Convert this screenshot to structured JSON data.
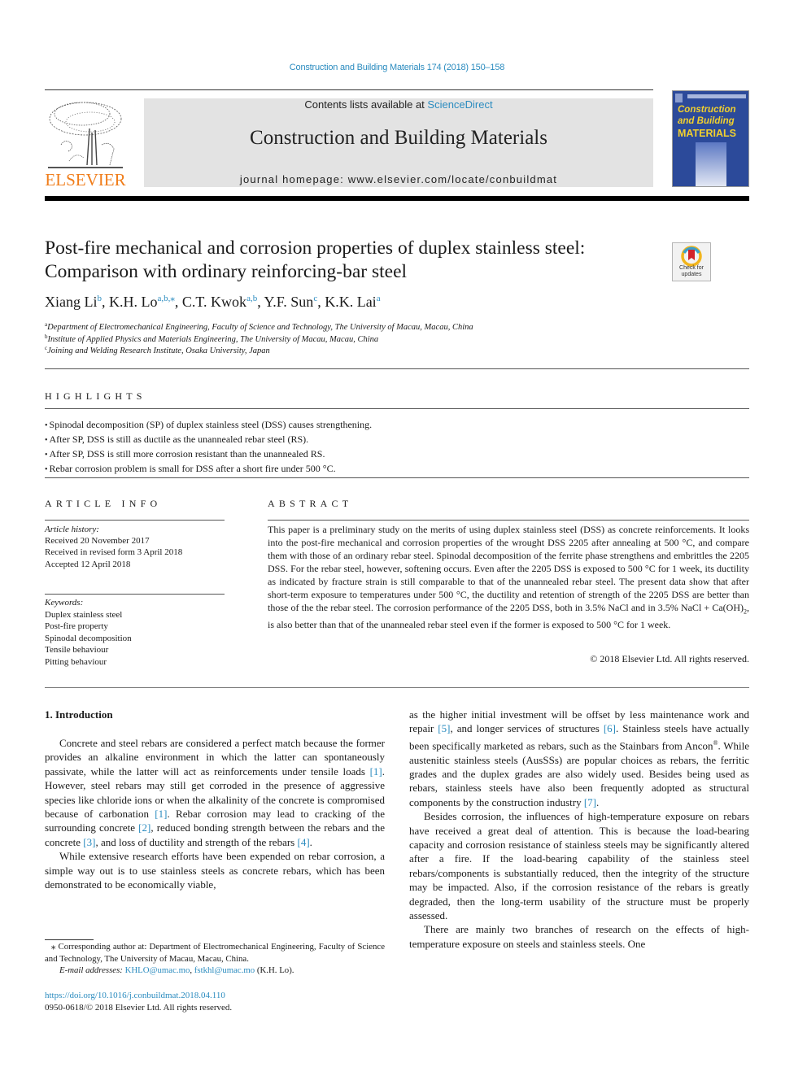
{
  "journal_ref": "Construction and Building Materials 174 (2018) 150–158",
  "masthead": {
    "publisher": "ELSEVIER",
    "contents_prefix": "Contents lists available at ",
    "contents_link": "ScienceDirect",
    "journal_title": "Construction and Building Materials",
    "homepage": "journal homepage: www.elsevier.com/locate/conbuildmat",
    "cover": {
      "line1": "Construction",
      "line2": "and Building",
      "line3": "MATERIALS"
    }
  },
  "crossmark": {
    "label_line1": "Check for",
    "label_line2": "updates"
  },
  "article": {
    "title_line1": "Post-fire mechanical and corrosion properties of duplex stainless steel:",
    "title_line2": "Comparison with ordinary reinforcing-bar steel",
    "authors": [
      {
        "name": "Xiang Li",
        "sup": "b",
        "sep": ", "
      },
      {
        "name": "K.H. Lo",
        "sup": "a,b,⁎",
        "sep": ", "
      },
      {
        "name": "C.T. Kwok",
        "sup": "a,b",
        "sep": ", "
      },
      {
        "name": "Y.F. Sun",
        "sup": "c",
        "sep": ", "
      },
      {
        "name": "K.K. Lai",
        "sup": "a",
        "sep": ""
      }
    ],
    "affiliations": [
      {
        "key": "a",
        "text": "Department of Electromechanical Engineering, Faculty of Science and Technology, The University of Macau, Macau, China"
      },
      {
        "key": "b",
        "text": "Institute of Applied Physics and Materials Engineering, The University of Macau, Macau, China"
      },
      {
        "key": "c",
        "text": "Joining and Welding Research Institute, Osaka University, Japan"
      }
    ]
  },
  "highlights": {
    "heading": "HIGHLIGHTS",
    "items": [
      "Spinodal decomposition (SP) of duplex stainless steel (DSS) causes strengthening.",
      "After SP, DSS is still as ductile as the unannealed rebar steel (RS).",
      "After SP, DSS is still more corrosion resistant than the unannealed RS.",
      "Rebar corrosion problem is small for DSS after a short fire under 500 °C."
    ]
  },
  "article_info": {
    "heading": "ARTICLE INFO",
    "history_label": "Article history:",
    "history": [
      "Received 20 November 2017",
      "Received in revised form 3 April 2018",
      "Accepted 12 April 2018"
    ],
    "keywords_label": "Keywords:",
    "keywords": [
      "Duplex stainless steel",
      "Post-fire property",
      "Spinodal decomposition",
      "Tensile behaviour",
      "Pitting behaviour"
    ]
  },
  "abstract": {
    "heading": "ABSTRACT",
    "text_before_sub": "This paper is a preliminary study on the merits of using duplex stainless steel (DSS) as concrete reinforcements. It looks into the post-fire mechanical and corrosion properties of the wrought DSS 2205 after annealing at 500 °C, and compare them with those of an ordinary rebar steel. Spinodal decomposition of the ferrite phase strengthens and embrittles the 2205 DSS. For the rebar steel, however, softening occurs. Even after the 2205 DSS is exposed to 500 °C for 1 week, its ductility as indicated by fracture strain is still comparable to that of the unannealed rebar steel. The present data show that after short-term exposure to temperatures under 500 °C, the ductility and retention of strength of the 2205 DSS are better than those of the the rebar steel. The corrosion performance of the 2205 DSS, both in 3.5% NaCl and in 3.5% NaCl + Ca(OH)",
    "sub": "2",
    "text_after_sub": ", is also better than that of the unannealed rebar steel even if the former is exposed to 500 °C for 1 week.",
    "copyright": "© 2018 Elsevier Ltd. All rights reserved."
  },
  "introduction": {
    "heading": "1. Introduction",
    "left_p1": [
      "Concrete and steel rebars are considered a perfect match because the former provides an alkaline environment in which the latter can spontaneously passivate, while the latter will act as reinforcements under tensile loads ",
      "[1]",
      ". However, steel rebars may still get corroded in the presence of aggressive species like chloride ions or when the alkalinity of the concrete is compromised because of carbonation ",
      "[1]",
      ". Rebar corrosion may lead to cracking of the surrounding concrete ",
      "[2]",
      ", reduced bonding strength between the rebars and the concrete ",
      "[3]",
      ", and loss of ductility and strength of the rebars ",
      "[4]",
      "."
    ],
    "left_p2": "While extensive research efforts have been expended on rebar corrosion, a simple way out is to use stainless steels as concrete rebars, which has been demonstrated to be economically viable,",
    "right_p1": [
      "as the higher initial investment will be offset by less maintenance work and repair ",
      "[5]",
      ", and longer services of structures ",
      "[6]",
      ". Stainless steels have actually been specifically marketed as rebars, such as the Stainbars from Ancon",
      "®",
      ". While austenitic stainless steels (AusSSs) are popular choices as rebars, the ferritic grades and the duplex grades are also widely used. Besides being used as rebars, stainless steels have also been frequently adopted as structural components by the construction industry ",
      "[7]",
      "."
    ],
    "right_p2": "Besides corrosion, the influences of high-temperature exposure on rebars have received a great deal of attention. This is because the load-bearing capacity and corrosion resistance of stainless steels may be significantly altered after a fire. If the load-bearing capability of the stainless steel rebars/components is substantially reduced, then the integrity of the structure may be impacted. Also, if the corrosion resistance of the rebars is greatly degraded, then the long-term usability of the structure must be properly assessed.",
    "right_p3": "There are mainly two branches of research on the effects of high-temperature exposure on steels and stainless steels. One"
  },
  "footnote": {
    "corresponding": "⁎ Corresponding author at: Department of Electromechanical Engineering, Faculty of Science and Technology, The University of Macau, Macau, China.",
    "email_label": "E-mail addresses: ",
    "email1": "KHLO@umac.mo",
    "email_sep": ", ",
    "email2": "fstkhl@umac.mo",
    "email_suffix": " (K.H. Lo).",
    "doi": "https://doi.org/10.1016/j.conbuildmat.2018.04.110",
    "issn": "0950-0618/© 2018 Elsevier Ltd. All rights reserved."
  }
}
